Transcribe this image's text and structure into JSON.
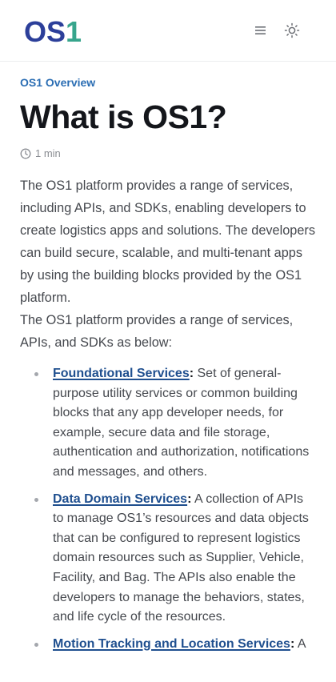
{
  "header": {
    "logo_os": "OS",
    "logo_one": "1",
    "menu_icon": "hamburger-menu-icon",
    "theme_icon": "sun-icon"
  },
  "breadcrumb": "OS1 Overview",
  "title": "What is OS1?",
  "read_time": "1 min",
  "paragraphs": [
    "The OS1 platform provides a range of services, including APIs, and SDKs, enabling developers to create logistics apps and solutions. The developers can build secure, scalable, and multi-tenant apps by using the building blocks provided by the OS1 platform.",
    "The OS1 platform provides a range of services, APIs, and SDKs as below:"
  ],
  "services": [
    {
      "link": "Foundational Services",
      "text": " Set of general-purpose utility services or common building blocks that any app developer needs, for example, secure data and file storage, authentication and authorization, notifications and messages, and others."
    },
    {
      "link": "Data Domain Services",
      "text": " A collection of APIs to manage OS1’s resources and data objects that can be configured to represent logistics domain resources such as Supplier, Vehicle, Facility, and Bag. The APIs also enable the developers to manage the behaviors, states, and life cycle of the resources."
    },
    {
      "link": "Motion Tracking and Location Services",
      "text": " A"
    }
  ],
  "colors": {
    "logo_os": "#2c3f9a",
    "logo_one": "#37a58c",
    "link": "#1f4f8f",
    "breadcrumb": "#2a6db3"
  }
}
